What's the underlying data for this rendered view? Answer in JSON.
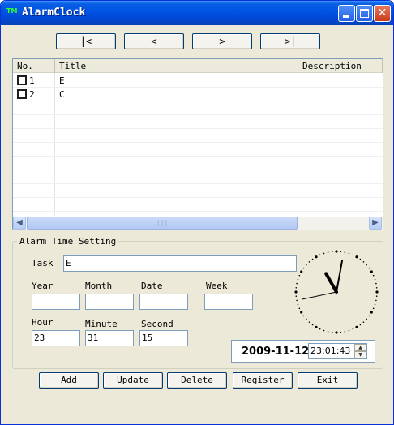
{
  "window": {
    "title": "AlarmClock",
    "icon_text": "TM"
  },
  "nav": {
    "first": "|<",
    "prev": "<",
    "next": ">",
    "last": ">|"
  },
  "list": {
    "columns": [
      "No.",
      "Title",
      "Description"
    ],
    "rows": [
      {
        "no": "1",
        "title": "E",
        "description": "",
        "checked": false
      },
      {
        "no": "2",
        "title": "C",
        "description": "",
        "checked": false
      }
    ]
  },
  "alarm": {
    "group_label": "Alarm Time Setting",
    "task_label": "Task",
    "task_value": "E",
    "year_label": "Year",
    "year_value": "",
    "month_label": "Month",
    "month_value": "",
    "date_label": "Date",
    "date_value": "",
    "week_label": "Week",
    "week_value": "",
    "hour_label": "Hour",
    "hour_value": "23",
    "minute_label": "Minute",
    "minute_value": "31",
    "second_label": "Second",
    "second_value": "15",
    "current_date": "2009-11-12",
    "current_time": "23:01:43"
  },
  "clock": {
    "hour": 23,
    "minute": 1,
    "second": 43
  },
  "buttons": {
    "add": "Add",
    "update": "Update",
    "delete": "Delete",
    "register": "Register",
    "exit": "Exit"
  },
  "icons": {
    "minimize": "minimize-icon",
    "maximize": "maximize-icon",
    "close": "close-icon",
    "scroll_left": "arrow-left-icon",
    "scroll_right": "arrow-right-icon",
    "spin_up": "arrow-up-icon",
    "spin_down": "arrow-down-icon"
  }
}
